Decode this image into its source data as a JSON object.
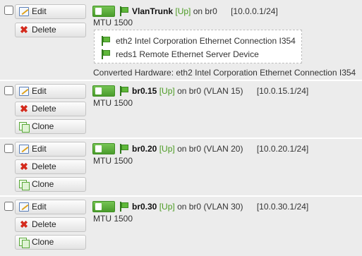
{
  "buttons": {
    "edit": "Edit",
    "delete": "Delete",
    "clone": "Clone"
  },
  "colors": {
    "status_up": "#4a9a21",
    "row_bg": "#ececec",
    "toggle_on": "#5aa83a"
  },
  "interfaces": [
    {
      "name": "VlanTrunk",
      "status": "[Up]",
      "parent": "on br0",
      "vlan": "",
      "address": "[10.0.0.1/24]",
      "mtu": "MTU 1500",
      "hardware": [
        {
          "icon": "nic-flag-icon",
          "label": "eth2 Intel Corporation Ethernet Connection I354"
        },
        {
          "icon": "nic-flag-icon",
          "label": "reds1 Remote Ethernet Server Device"
        }
      ],
      "converted_hardware": "Converted Hardware: eth2 Intel Corporation Ethernet Connection I354"
    },
    {
      "name": "br0.15",
      "status": "[Up]",
      "parent": "on br0",
      "vlan": "(VLAN 15)",
      "address": "[10.0.15.1/24]",
      "mtu": "MTU 1500"
    },
    {
      "name": "br0.20",
      "status": "[Up]",
      "parent": "on br0",
      "vlan": "(VLAN 20)",
      "address": "[10.0.20.1/24]",
      "mtu": "MTU 1500"
    },
    {
      "name": "br0.30",
      "status": "[Up]",
      "parent": "on br0",
      "vlan": "(VLAN 30)",
      "address": "[10.0.30.1/24]",
      "mtu": "MTU 1500"
    }
  ]
}
